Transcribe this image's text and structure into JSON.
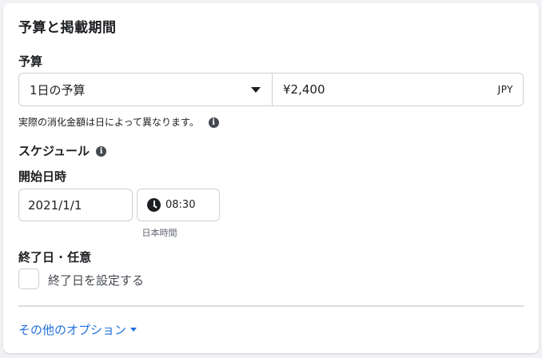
{
  "section_title": "予算と掲載期間",
  "budget": {
    "label": "予算",
    "type_value": "1日の予算",
    "amount_value": "¥2,400",
    "currency": "JPY",
    "note": "実際の消化金額は日によって異なります。"
  },
  "schedule": {
    "label": "スケジュール",
    "start_label": "開始日時",
    "start_date": "2021/1/1",
    "start_time": "08:30",
    "timezone": "日本時間",
    "end_label": "終了日 · 任意",
    "end_checkbox_label": "終了日を設定する",
    "end_checked": false
  },
  "more_options_label": "その他のオプション",
  "icons": {
    "info": "info-icon",
    "clock": "clock-icon",
    "dropdown": "caret-down-icon"
  },
  "colors": {
    "link": "#216fdb",
    "border": "#ccd0d5",
    "background": "#f0f2f5"
  }
}
